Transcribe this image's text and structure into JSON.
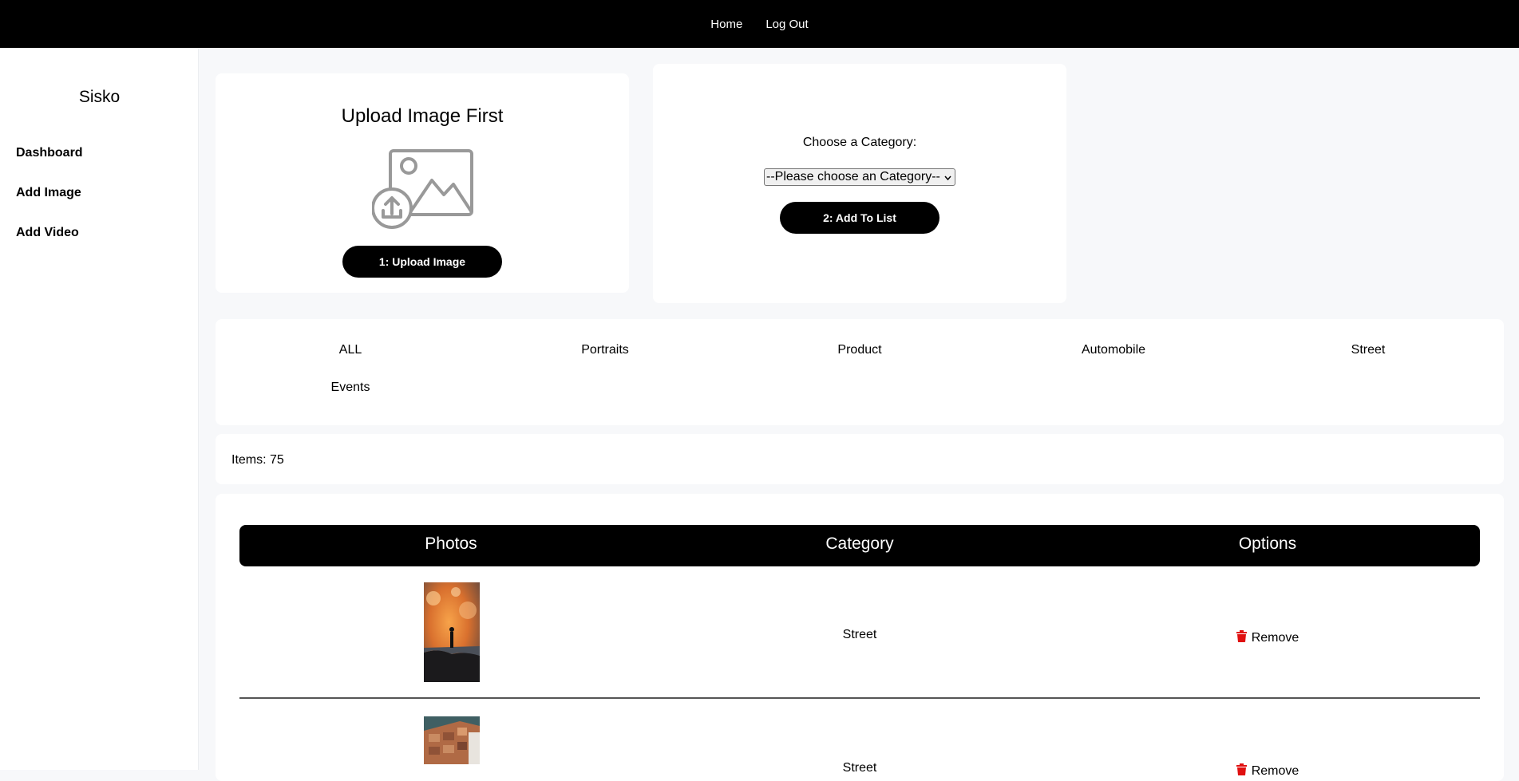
{
  "topnav": {
    "home": "Home",
    "logout": "Log Out"
  },
  "sidebar": {
    "brand": "Sisko",
    "items": [
      {
        "label": "Dashboard"
      },
      {
        "label": "Add Image"
      },
      {
        "label": "Add Video"
      }
    ]
  },
  "upload": {
    "title": "Upload Image First",
    "button": "1: Upload Image",
    "icon": "image-upload-icon"
  },
  "category": {
    "label": "Choose a Category:",
    "select_value": "--Please choose an Category--",
    "button": "2: Add To List"
  },
  "filters": [
    "ALL",
    "Portraits",
    "Product",
    "Automobile",
    "Street",
    "Events"
  ],
  "items_label": "Items: 75",
  "table": {
    "headers": [
      "Photos",
      "Category",
      "Options"
    ],
    "rows": [
      {
        "category": "Street",
        "option": "Remove"
      },
      {
        "category": "Street",
        "option": "Remove"
      }
    ]
  },
  "colors": {
    "remove_icon": "#e01010",
    "nav_bg": "#000000"
  }
}
